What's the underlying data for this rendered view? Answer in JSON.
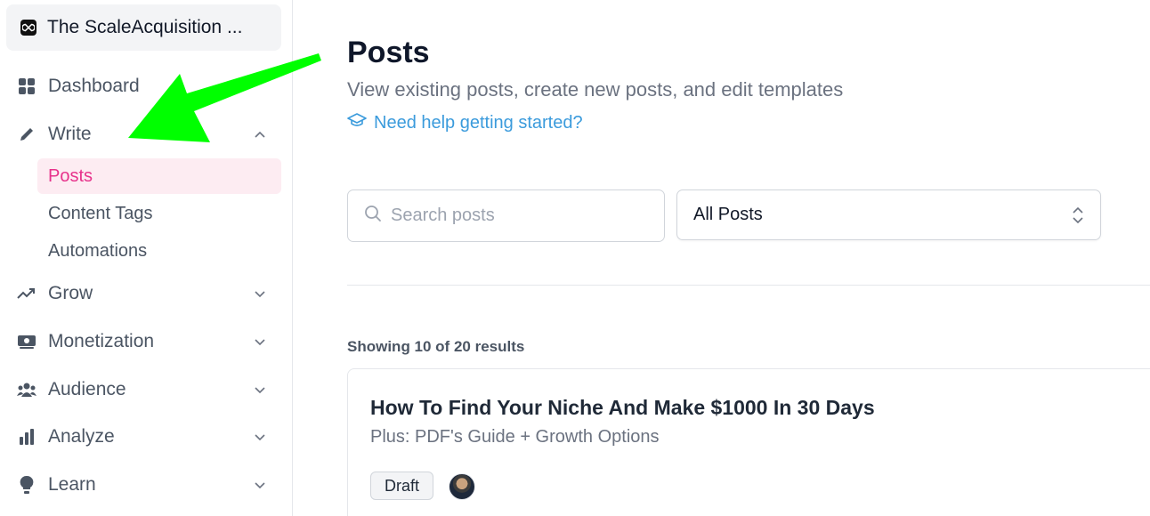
{
  "workspace": {
    "name": "The ScaleAcquisition ..."
  },
  "sidebar": {
    "dashboard": "Dashboard",
    "write": "Write",
    "write_sub": {
      "posts": "Posts",
      "content_tags": "Content Tags",
      "automations": "Automations"
    },
    "grow": "Grow",
    "monetization": "Monetization",
    "audience": "Audience",
    "analyze": "Analyze",
    "learn": "Learn"
  },
  "header": {
    "title": "Posts",
    "subtitle": "View existing posts, create new posts, and edit templates",
    "help_link": "Need help getting started?"
  },
  "filters": {
    "search_placeholder": "Search posts",
    "search_value": "",
    "select_value": "All Posts"
  },
  "results_text": "Showing 10 of 20 results",
  "posts": [
    {
      "title": "How To Find Your Niche And Make $1000 In 30 Days",
      "subtitle": "Plus: PDF's Guide + Growth Options",
      "status": "Draft"
    }
  ],
  "colors": {
    "accent_pink": "#e7328b",
    "active_bg": "#fdecf2",
    "link_blue": "#3b9bdc",
    "annotation_green": "#00ff00"
  },
  "icons": {
    "dashboard": "grid-icon",
    "write": "pencil-icon",
    "grow": "trending-up-icon",
    "monetization": "money-icon",
    "audience": "users-icon",
    "analyze": "bar-chart-icon",
    "learn": "lightbulb-icon"
  }
}
